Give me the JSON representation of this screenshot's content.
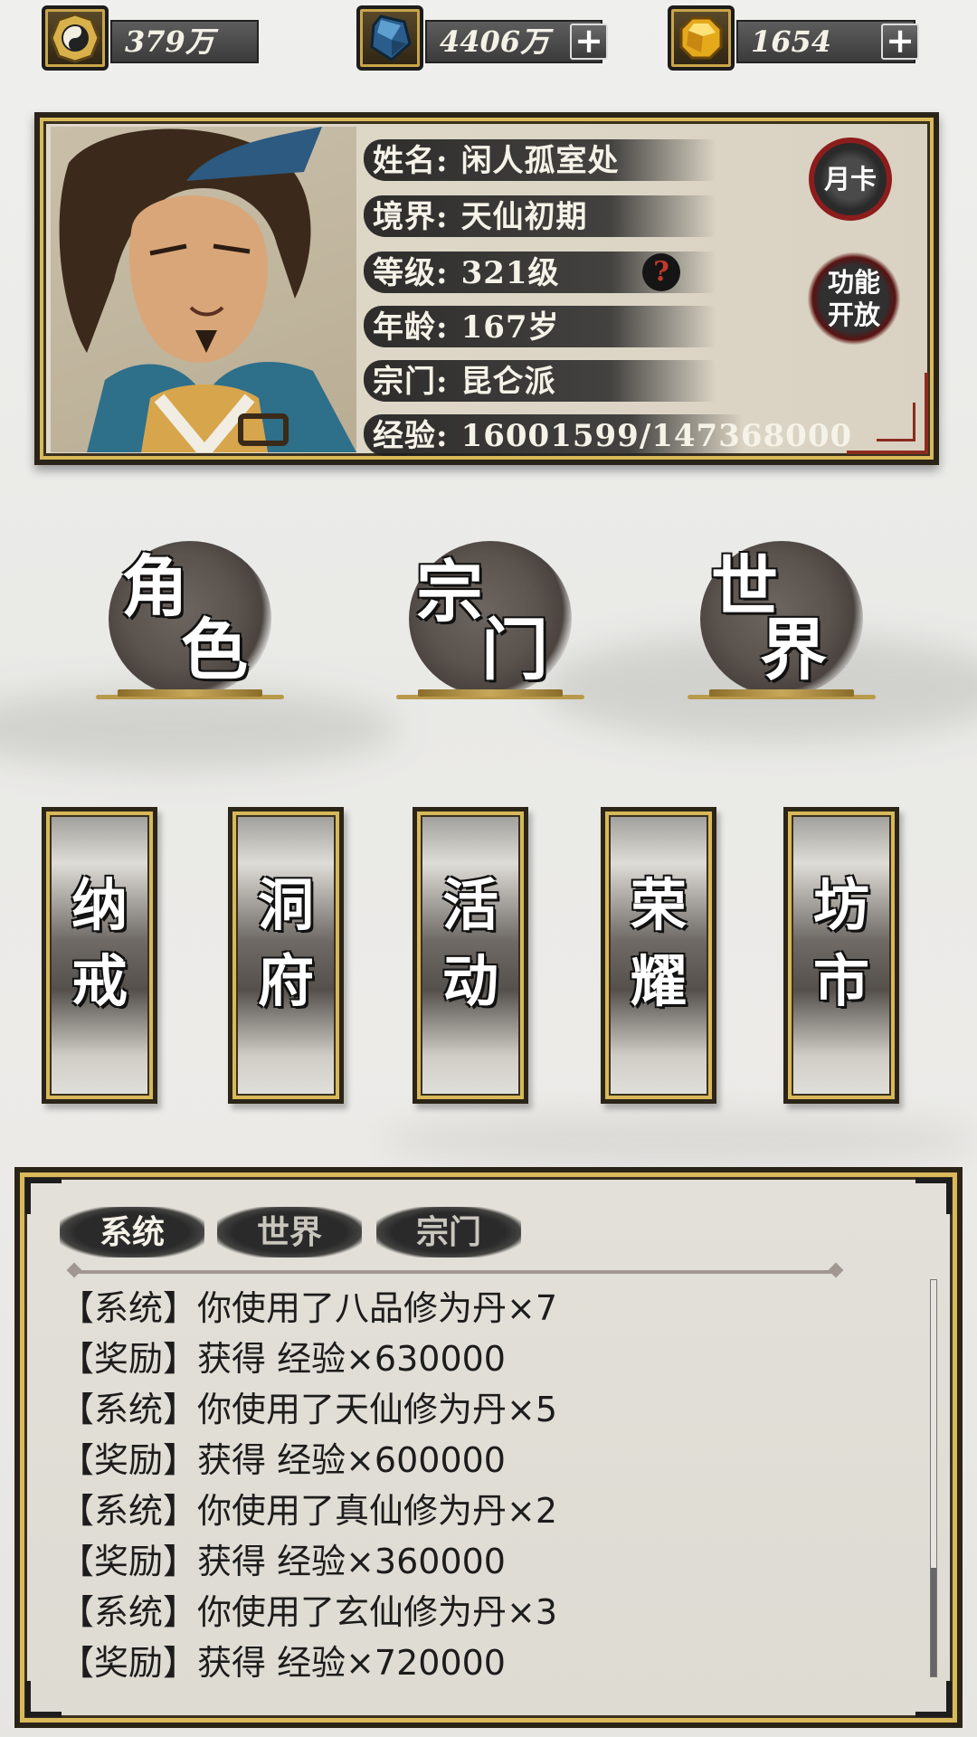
{
  "currencies": [
    {
      "icon": "yin-yang-coin-icon",
      "value": "379万",
      "has_add": false
    },
    {
      "icon": "blue-crystal-icon",
      "value": "4406万",
      "has_add": true
    },
    {
      "icon": "gold-gem-icon",
      "value": "1654",
      "has_add": true
    }
  ],
  "profile": {
    "name_label": "姓名:",
    "name": "闲人孤室处",
    "realm_label": "境界:",
    "realm": "天仙初期",
    "level_label": "等级:",
    "level": "321级",
    "level_help": "?",
    "age_label": "年龄:",
    "age": "167岁",
    "sect_label": "宗门:",
    "sect": "昆仑派",
    "exp_label": "经验:",
    "exp": "16001599/147368000",
    "month_card": "月卡",
    "func_open": "功能开放"
  },
  "main_buttons": [
    {
      "line1": "角",
      "line2": "色"
    },
    {
      "line1": "宗",
      "line2": "门"
    },
    {
      "line1": "世",
      "line2": "界"
    }
  ],
  "scroll_buttons": [
    {
      "line1": "纳",
      "line2": "戒"
    },
    {
      "line1": "洞",
      "line2": "府"
    },
    {
      "line1": "活",
      "line2": "动"
    },
    {
      "line1": "荣",
      "line2": "耀"
    },
    {
      "line1": "坊",
      "line2": "市"
    }
  ],
  "chat": {
    "tabs": [
      "系统",
      "世界",
      "宗门"
    ],
    "active_tab": "系统",
    "messages": [
      "【系统】你使用了八品修为丹×7",
      "【奖励】获得 经验×630000",
      "【系统】你使用了天仙修为丹×5",
      "【奖励】获得 经验×600000",
      "【系统】你使用了真仙修为丹×2",
      "【奖励】获得 经验×360000",
      "【系统】你使用了玄仙修为丹×3",
      "【奖励】获得 经验×720000"
    ]
  },
  "colors": {
    "gold_trim": "#d9b95a",
    "frame_dark": "#2a2418",
    "seal_red": "#8d1d1d"
  }
}
